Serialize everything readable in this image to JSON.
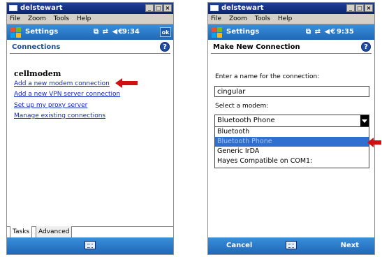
{
  "screens": [
    {
      "window": {
        "title": "delstewart",
        "buttons": [
          "_",
          "□",
          "×"
        ]
      },
      "menu": [
        "File",
        "Zoom",
        "Tools",
        "Help"
      ],
      "navbar": {
        "title": "Settings",
        "time": "9:34",
        "ok": "ok"
      },
      "page_title": "Connections",
      "section_heading": "cellmodem",
      "links": [
        "Add a new modem connection",
        "Add a new VPN server connection",
        "Set up my proxy server",
        "Manage existing connections"
      ],
      "tabs": [
        "Tasks",
        "Advanced"
      ]
    },
    {
      "window": {
        "title": "delstewart",
        "buttons": [
          "_",
          "□",
          "×"
        ]
      },
      "menu": [
        "File",
        "Zoom",
        "Tools",
        "Help"
      ],
      "navbar": {
        "title": "Settings",
        "time": "9:35"
      },
      "page_title": "Make New Connection",
      "name_label": "Enter a name for the connection:",
      "name_value": "cingular",
      "modem_label": "Select a modem:",
      "modem_selected": "Bluetooth Phone",
      "modem_options": [
        "Bluetooth",
        "Bluetooth Phone",
        "Generic IrDA",
        "Hayes Compatible on COM1:"
      ],
      "softkeys": {
        "left": "Cancel",
        "right": "Next"
      }
    }
  ],
  "colors": {
    "accent_blue": "#1f68b8",
    "link": "#1428c8",
    "arrow": "#d01010",
    "selection": "#2f6fd0"
  },
  "icons": [
    "windows-start-icon",
    "network-icon",
    "sync-icon",
    "volume-icon",
    "help-icon",
    "keyboard-icon",
    "red-arrow-icon"
  ]
}
